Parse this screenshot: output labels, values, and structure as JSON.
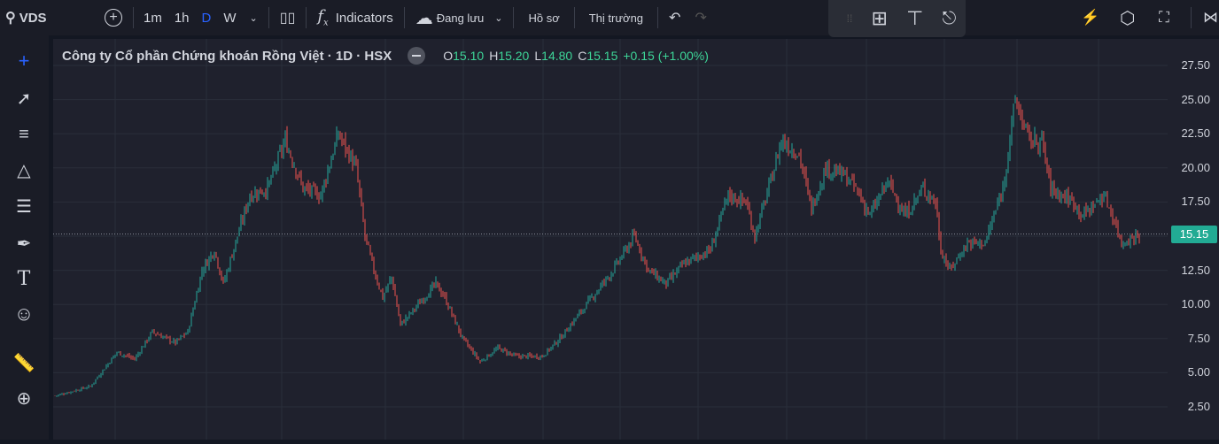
{
  "toolbar": {
    "symbol": "VDS",
    "intervals": [
      "1m",
      "1h",
      "D",
      "W"
    ],
    "active_interval": "D",
    "indicators": "Indicators",
    "saved": "Đang lưu",
    "profile": "Hồ sơ",
    "market": "Thị trường"
  },
  "legend": {
    "title": "Công ty Cổ phần Chứng khoán Rồng Việt · 1D · HSX",
    "o_label": "O",
    "o": "15.10",
    "h_label": "H",
    "h": "15.20",
    "l_label": "L",
    "l": "14.80",
    "c_label": "C",
    "c": "15.15",
    "change": "+0.15 (+1.00%)"
  },
  "colors": {
    "up": "#26a69a",
    "down": "#ef5350",
    "accent": "#2962ff",
    "last": "#22ab94"
  },
  "chart_data": {
    "type": "candlestick",
    "ylim": [
      0.5,
      28.5
    ],
    "yticks": [
      "27.50",
      "25.00",
      "22.50",
      "20.00",
      "17.50",
      "15.00",
      "12.50",
      "10.00",
      "7.50",
      "5.00",
      "2.50"
    ],
    "last_price": "15.15",
    "path": [
      [
        0,
        3.3
      ],
      [
        20,
        4.0
      ],
      [
        35,
        6.5
      ],
      [
        45,
        6.0
      ],
      [
        55,
        8.0
      ],
      [
        68,
        7.2
      ],
      [
        75,
        8.0
      ],
      [
        83,
        12.5
      ],
      [
        90,
        14.0
      ],
      [
        95,
        11.5
      ],
      [
        103,
        15
      ],
      [
        110,
        18
      ],
      [
        120,
        18.5
      ],
      [
        130,
        22
      ],
      [
        140,
        18.5
      ],
      [
        150,
        18
      ],
      [
        160,
        22.5
      ],
      [
        170,
        20
      ],
      [
        175,
        15
      ],
      [
        180,
        12.5
      ],
      [
        185,
        10.5
      ],
      [
        190,
        12
      ],
      [
        195,
        8.5
      ],
      [
        205,
        10
      ],
      [
        215,
        11.5
      ],
      [
        220,
        10.5
      ],
      [
        230,
        7.5
      ],
      [
        240,
        5.8
      ],
      [
        250,
        6.8
      ],
      [
        260,
        6.2
      ],
      [
        275,
        6.2
      ],
      [
        285,
        7.5
      ],
      [
        300,
        10
      ],
      [
        315,
        12.5
      ],
      [
        327,
        15
      ],
      [
        335,
        12.5
      ],
      [
        345,
        11.5
      ],
      [
        355,
        13
      ],
      [
        370,
        14
      ],
      [
        380,
        18
      ],
      [
        390,
        17.5
      ],
      [
        395,
        15
      ],
      [
        405,
        19.5
      ],
      [
        410,
        22
      ],
      [
        420,
        21
      ],
      [
        427,
        17
      ],
      [
        435,
        20
      ],
      [
        445,
        19.5
      ],
      [
        452,
        18.5
      ],
      [
        460,
        16.5
      ],
      [
        470,
        19
      ],
      [
        480,
        16.5
      ],
      [
        490,
        18.5
      ],
      [
        497,
        17.5
      ],
      [
        500,
        14
      ],
      [
        505,
        12.5
      ],
      [
        515,
        14.5
      ],
      [
        525,
        14.5
      ],
      [
        535,
        18.5
      ],
      [
        542,
        25
      ],
      [
        550,
        22
      ],
      [
        557,
        22
      ],
      [
        562,
        18.5
      ],
      [
        575,
        17.5
      ],
      [
        580,
        16.5
      ],
      [
        592,
        18
      ],
      [
        597,
        16.5
      ],
      [
        602,
        14.5
      ],
      [
        612,
        15.15
      ]
    ]
  }
}
